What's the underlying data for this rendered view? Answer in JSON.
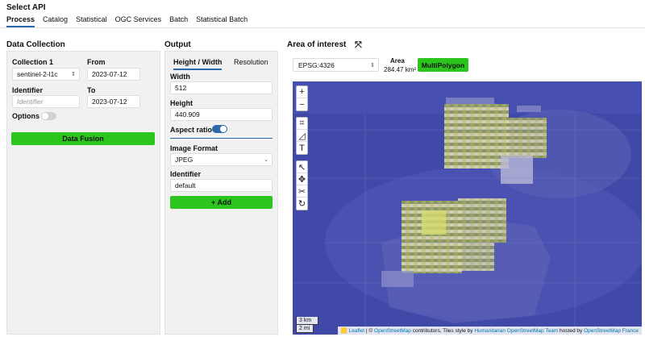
{
  "header": {
    "title": "Select API",
    "tabs": [
      "Process",
      "Catalog",
      "Statistical",
      "OGC Services",
      "Batch",
      "Statistical Batch"
    ]
  },
  "data_collection": {
    "heading": "Data Collection",
    "collection_label": "Collection 1",
    "collection_value": "sentinel-2-l1c",
    "from_label": "From",
    "from_value": "2023-07-12",
    "identifier_label": "Identifier",
    "identifier_placeholder": "Identifier",
    "to_label": "To",
    "to_value": "2023-07-12",
    "options_label": "Options",
    "options_enabled": false,
    "fusion_button": "Data Fusion"
  },
  "output": {
    "heading": "Output",
    "tabs": [
      "Height / Width",
      "Resolution"
    ],
    "width_label": "Width",
    "width_value": "512",
    "height_label": "Height",
    "height_value": "440.909",
    "aspect_label": "Aspect ratio",
    "aspect_enabled": true,
    "format_label": "Image Format",
    "format_value": "JPEG",
    "identifier_label": "Identifier",
    "identifier_value": "default",
    "add_button": "+ Add"
  },
  "aoi": {
    "heading": "Area of interest",
    "crs_value": "EPSG:4326",
    "area_label": "Area",
    "area_value": "284.47 km²",
    "geometry_badge": "MultiPolygon"
  },
  "map": {
    "zoom_in": "+",
    "zoom_out": "−",
    "scale_km": "3 km",
    "scale_mi": "2 mi",
    "attribution": {
      "leaflet": "Leaflet",
      "sep": " | © ",
      "osm": "OpenStreetMap",
      "contrib": " contributors, Tiles style by ",
      "hot": "Humanitarian OpenStreetMap Team",
      "hosted": " hosted by ",
      "osmfr": "OpenStreetMap France"
    }
  },
  "colors": {
    "accent": "#2a68b0",
    "green": "#2cc51d",
    "map_overlay": "#3f48a6"
  }
}
